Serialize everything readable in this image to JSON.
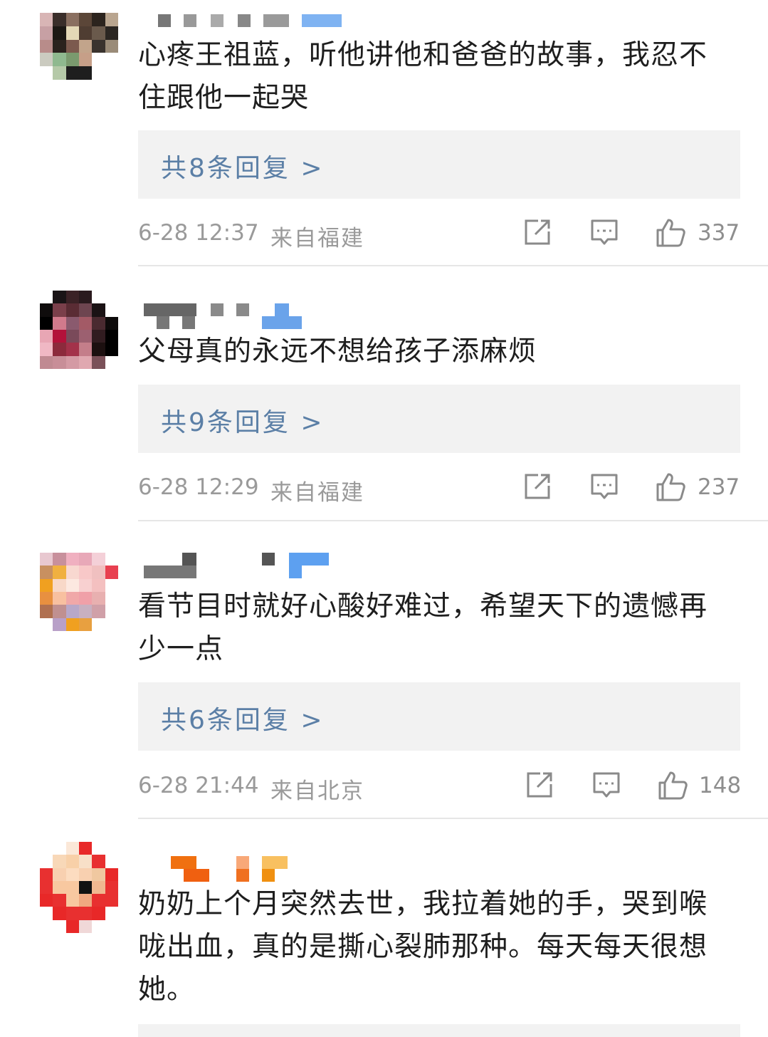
{
  "comments": [
    {
      "text_lines": [
        "心疼王祖蓝，听他讲他和爸爸的故事，我忍不",
        "住跟他一起哭"
      ],
      "replies": "共8条回复 >",
      "time": "6-28 12:37",
      "location": "来自福建",
      "likes": "337"
    },
    {
      "text_lines": [
        "父母真的永远不想给孩子添麻烦"
      ],
      "replies": "共9条回复 >",
      "time": "6-28 12:29",
      "location": "来自福建",
      "likes": "237"
    },
    {
      "text_lines": [
        "看节目时就好心酸好难过，希望天下的遗憾再",
        "少一点"
      ],
      "replies": "共6条回复 >",
      "time": "6-28 21:44",
      "location": "来自北京",
      "likes": "148"
    },
    {
      "text_lines": [
        "奶奶上个月突然去世，我拉着她的手，哭到喉",
        "咙出血，真的是撕心裂肺那种。每天每天很想",
        "她。"
      ]
    }
  ],
  "icons": {
    "share": "share-icon",
    "comment": "comment-icon",
    "like": "thumbs-up-icon"
  },
  "colors": {
    "reply_link": "#5b7fa6",
    "meta_text": "#9a9a9a",
    "reply_bg": "#f2f2f2"
  }
}
